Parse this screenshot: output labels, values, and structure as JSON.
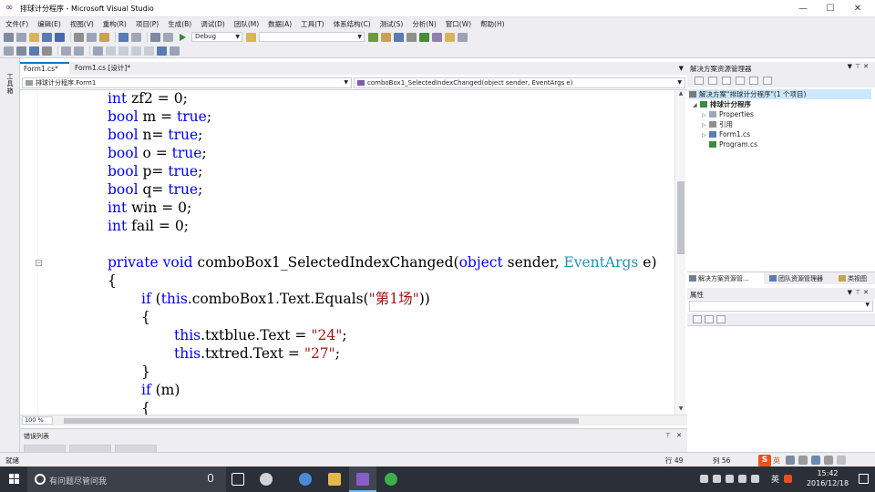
{
  "window": {
    "title": "排球计分程序 - Microsoft Visual Studio",
    "buttons": {
      "minimize": "—",
      "maximize": "☐",
      "close": "✕"
    }
  },
  "menu": [
    "文件(F)",
    "编辑(E)",
    "视图(V)",
    "重构(R)",
    "项目(P)",
    "生成(B)",
    "调试(D)",
    "团队(M)",
    "数据(A)",
    "工具(T)",
    "体系结构(C)",
    "测试(S)",
    "分析(N)",
    "窗口(W)",
    "帮助(H)"
  ],
  "toolbar": {
    "config": "Debug",
    "platform": ""
  },
  "left_strip": {
    "label": "工具箱"
  },
  "doc_tabs": [
    {
      "label": "Form1.cs*"
    },
    {
      "label": "Form1.cs [设计]*"
    }
  ],
  "nav": {
    "class": "排球计分程序.Form1",
    "member": "comboBox1_SelectedIndexChanged(object sender, EventArgs e)"
  },
  "code": {
    "l1": {
      "kw": "int",
      "rest": " zf2 = 0;"
    },
    "l2": {
      "kw": "bool",
      "a": " m = ",
      "b": "true",
      "c": ";"
    },
    "l3": {
      "kw": "bool",
      "a": " n= ",
      "b": "true",
      "c": ";"
    },
    "l4": {
      "kw": "bool",
      "a": " o = ",
      "b": "true",
      "c": ";"
    },
    "l5": {
      "kw": "bool",
      "a": " p= ",
      "b": "true",
      "c": ";"
    },
    "l6": {
      "kw": "bool",
      "a": " q= ",
      "b": "true",
      "c": ";"
    },
    "l7": {
      "kw": "int",
      "rest": " win = 0;"
    },
    "l8": {
      "kw": "int",
      "rest": " fail = 0;"
    },
    "l9": {
      "kw1": "private",
      "kw2": "void",
      "name": " comboBox1_SelectedIndexChanged(",
      "kw3": "object",
      "mid": " sender, ",
      "type": "EventArgs",
      "end": " e)"
    },
    "l10": "{",
    "l11": {
      "kw": "if",
      "a": " (",
      "kw2": "this",
      "b": ".comboBox1.Text.Equals(",
      "str": "\"第1场\"",
      "c": "))"
    },
    "l12": "{",
    "l13": {
      "kw": "this",
      "a": ".txtblue.Text = ",
      "str": "\"24\"",
      "c": ";"
    },
    "l14": {
      "kw": "this",
      "a": ".txtred.Text = ",
      "str": "\"27\"",
      "c": ";"
    },
    "l15": "}",
    "l16": {
      "kw": "if",
      "a": " (m)"
    },
    "l17": "{"
  },
  "zoom": "100 %",
  "error_list": {
    "title": "错误列表"
  },
  "solution_explorer": {
    "title": "解决方案资源管理器",
    "root": "解决方案\"排球计分程序\"(1 个项目)",
    "project": "排球计分程序",
    "items": [
      "Properties",
      "引用",
      "Form1.cs",
      "Program.cs"
    ]
  },
  "right_tabs": [
    "解决方案资源管...",
    "团队资源管理器",
    "类视图"
  ],
  "properties": {
    "title": "属性"
  },
  "status": {
    "ready": "就绪",
    "row": "行 49",
    "col": "列 56"
  },
  "ime": {
    "lang": "英"
  },
  "taskbar": {
    "search_placeholder": "有问题尽管问我",
    "lang": "英",
    "time": "15:42",
    "date": "2016/12/18"
  },
  "colors": {
    "accent": "#007acc",
    "keyword": "#0000ff",
    "type": "#2b91af",
    "string": "#a31515"
  }
}
